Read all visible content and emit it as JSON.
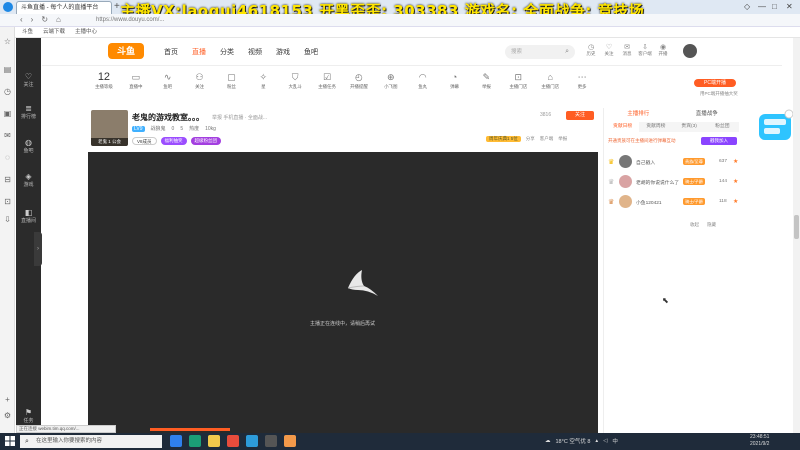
{
  "browser": {
    "tab_title": "斗鱼直播 - 每个人的直播平台",
    "new_tab": "+",
    "url": "https://www.douyu.com/...",
    "bookmarks": [
      "斗鱼",
      "云端下载",
      "主播中心"
    ],
    "status_url": "正在连接 webim.tim.qq.com/...",
    "window_controls": [
      "◇",
      "—",
      "□",
      "✕"
    ]
  },
  "overlay": {
    "banner": "主播VX:laogui4618153 开黑歪歪: 303383 游戏名: 全面战争: 竞技场"
  },
  "site_sidebar": [
    {
      "label": "关注",
      "icon": "heart-icon"
    },
    {
      "label": "排行榜",
      "icon": "list-icon"
    },
    {
      "label": "鱼吧",
      "icon": "chat-icon"
    },
    {
      "label": "游戏",
      "icon": "gamepad-icon"
    },
    {
      "label": "直播间",
      "icon": "bag-icon"
    },
    {
      "label": "任务",
      "icon": "flag-icon"
    }
  ],
  "header": {
    "logo": "斗鱼",
    "nav": [
      "首页",
      "直播",
      "分类",
      "视频",
      "游戏",
      "鱼吧"
    ],
    "active_nav": "直播",
    "search_placeholder": "搜索",
    "tools": [
      "历史",
      "关注",
      "消息",
      "客户端",
      "开播"
    ]
  },
  "categories": {
    "first_num": "12",
    "first_label": "主播等级",
    "items": [
      "直播中",
      "鱼吧",
      "关注",
      "粉丝",
      "星",
      "大乱斗",
      "分享",
      "主播任务",
      "开播提醒",
      "小飞图",
      "鱼丸",
      "弹幕",
      "举报",
      "更多",
      "主播门店",
      "更多"
    ],
    "pc_button": "PC端开播",
    "pc_sub": "用PC端开播抽大奖"
  },
  "streamer": {
    "title": "老鬼的游戏教室。。。",
    "meta": "举报   手机直播 · 全面战...",
    "level": "LV9",
    "name": "战狼鬼",
    "stats": [
      "0",
      "5",
      "热度",
      "10kg"
    ],
    "badge": "老鬼 1 公会",
    "tags": [
      "V8成员",
      "福利抽奖",
      "超级粉丝团"
    ],
    "report": "3816",
    "follow": "关注",
    "right_actions": [
      "周年庆典1 5位",
      "分享",
      "客户端",
      "举报"
    ]
  },
  "player": {
    "message": "主播正在连线中，请稍后再试"
  },
  "rightpanel": {
    "head": [
      "主播排行",
      "直播战争"
    ],
    "tabs": [
      "贡献日榜",
      "贡献周榜",
      "贵宾(3)",
      "粉丝团"
    ],
    "notice": "开通贵族可在主播间进行弹幕互动",
    "join_btn": "戳我加入",
    "ranks": [
      {
        "name": "自己戳入",
        "level": "贵族/至尊",
        "score": "637",
        "crown_color": "#f5b800"
      },
      {
        "name": "老胡的你说说什么了",
        "level": "骑士/子爵",
        "score": "144",
        "crown_color": "#b7b7b7"
      },
      {
        "name": "小鱼120421",
        "level": "骑士/子爵",
        "score": "118",
        "crown_color": "#d88b4a"
      }
    ],
    "footer": [
      "收起",
      "隐藏"
    ]
  },
  "taskbar": {
    "search_placeholder": "在这里输入你要搜索的内容",
    "weather": "18°C 空气优 8",
    "time": "23:48:51",
    "date": "2021/9/2",
    "lang": "中"
  }
}
